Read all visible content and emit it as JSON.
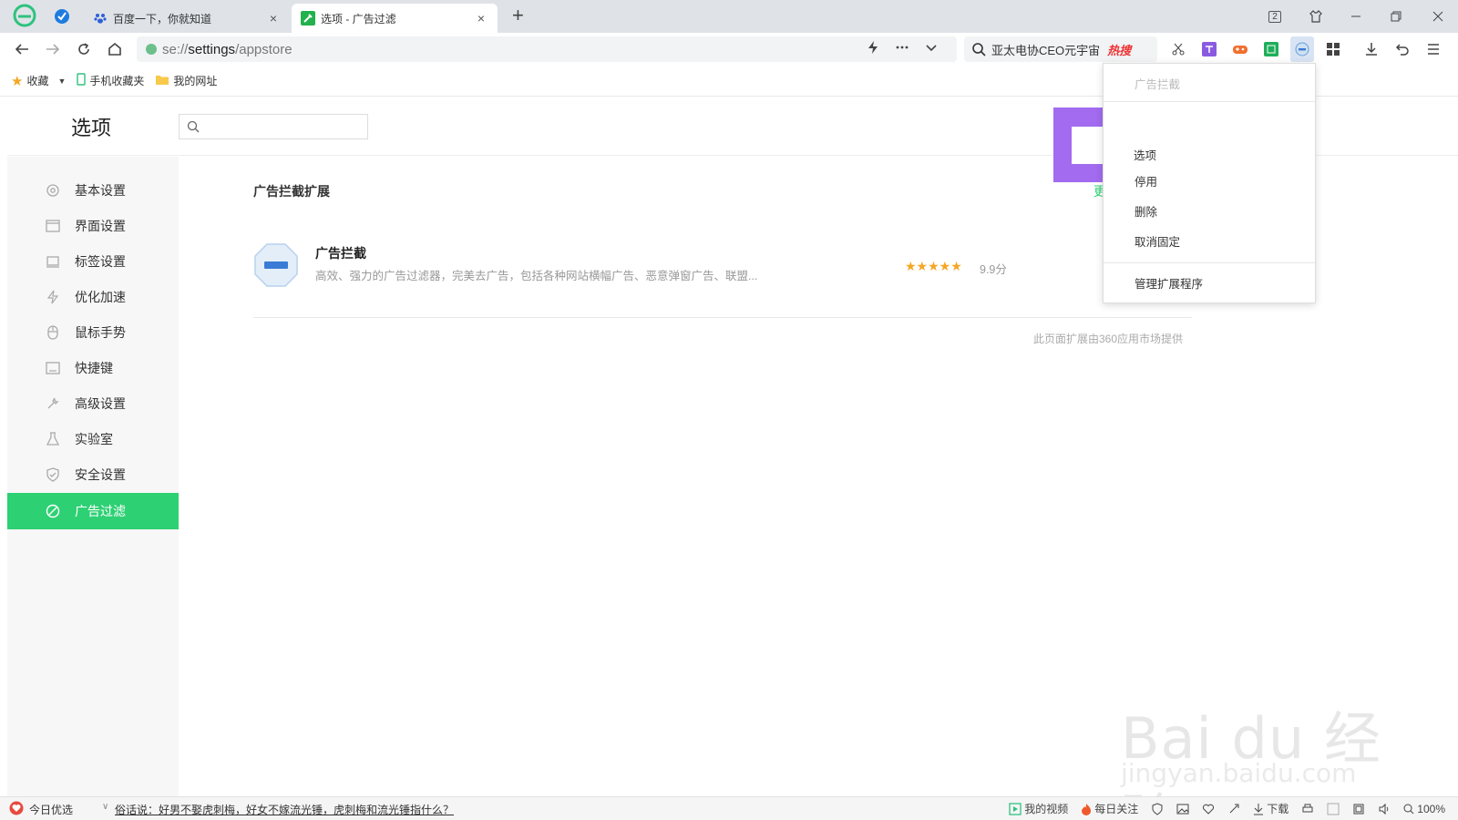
{
  "tabs": [
    {
      "title": "百度一下，你就知道",
      "close": "×"
    },
    {
      "title": "选项 - 广告过滤",
      "close": "×"
    }
  ],
  "newtab": "+",
  "window_controls": {
    "tab_count": "2"
  },
  "address_bar": {
    "scheme": "se://",
    "host": "settings",
    "path": "/appstore"
  },
  "search_box": {
    "query": "亚太电协CEO元宇宙",
    "hot_label": "热搜"
  },
  "bookmarks": {
    "favorites": "收藏",
    "mobile": "手机收藏夹",
    "mysites": "我的网址"
  },
  "settings": {
    "title": "选项",
    "search_placeholder": ""
  },
  "sidebar": {
    "items": [
      {
        "label": "基本设置",
        "icon": "gear-icon"
      },
      {
        "label": "界面设置",
        "icon": "window-icon"
      },
      {
        "label": "标签设置",
        "icon": "tab-icon"
      },
      {
        "label": "优化加速",
        "icon": "lightning-icon"
      },
      {
        "label": "鼠标手势",
        "icon": "mouse-icon"
      },
      {
        "label": "快捷键",
        "icon": "keyboard-icon"
      },
      {
        "label": "高级设置",
        "icon": "wrench-icon"
      },
      {
        "label": "实验室",
        "icon": "flask-icon"
      },
      {
        "label": "安全设置",
        "icon": "shield-icon"
      },
      {
        "label": "广告过滤",
        "icon": "block-icon",
        "active": true
      }
    ]
  },
  "main": {
    "section_title": "广告拦截扩展",
    "more": "更",
    "extension": {
      "name": "广告拦截",
      "description": "高效、强力的广告过滤器，完美去广告，包括各种网站横幅广告、恶意弹窗广告、联盟...",
      "stars": "★★★★★",
      "score": "9.9分"
    },
    "footnote": "此页面扩展由360应用市场提供"
  },
  "context_menu": {
    "header": "广告拦截",
    "items": [
      "选项",
      "停用",
      "删除",
      "取消固定"
    ],
    "manage": "管理扩展程序"
  },
  "statusbar": {
    "today": "今日优选",
    "news": "俗话说：好男不娶虎刺梅，好女不嫁流光锤，虎刺梅和流光锤指什么？",
    "video": "我的视频",
    "follow": "每日关注",
    "download": "下载",
    "zoom": "100%"
  },
  "watermark": {
    "main": "Bai du 经验",
    "sub": "jingyan.baidu.com"
  },
  "colors": {
    "accent": "#2ed074",
    "highlight": "#a26bf0",
    "hot": "#ee3333",
    "star": "#f5a623"
  }
}
